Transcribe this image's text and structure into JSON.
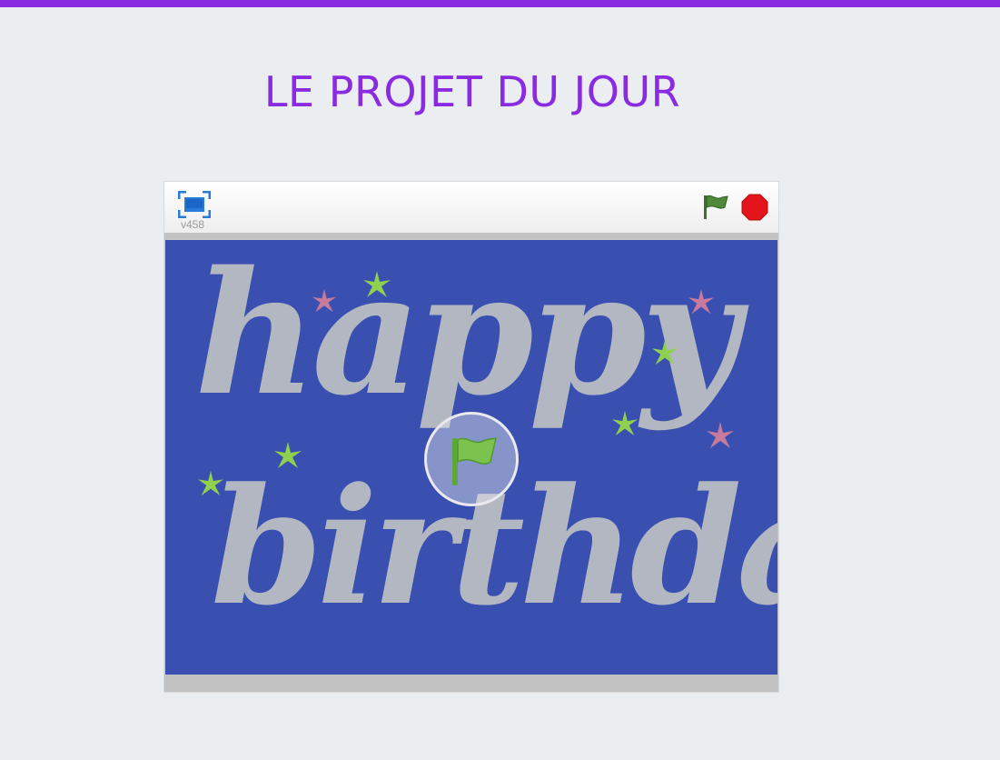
{
  "page": {
    "title": "LE PROJET DU JOUR"
  },
  "player": {
    "version": "v458",
    "stage_text": {
      "line1": "happy",
      "line2": "birthday"
    },
    "icons": {
      "fullscreen": "fullscreen-icon",
      "green_flag": "green-flag-icon",
      "stop": "stop-icon",
      "play_overlay": "green-flag-play-icon",
      "sparkle": "sparkle-icon"
    }
  },
  "colors": {
    "accent": "#8a2be2",
    "stage_background": "#3a50b0",
    "greeting_text": "#b3b7c2",
    "sparkle_green": "#8fd14f",
    "sparkle_pink": "#c77a9c",
    "flag_green": "#4e8a3a",
    "stop_red": "#e3141b",
    "fullscreen_blue": "#2a7bd8"
  }
}
